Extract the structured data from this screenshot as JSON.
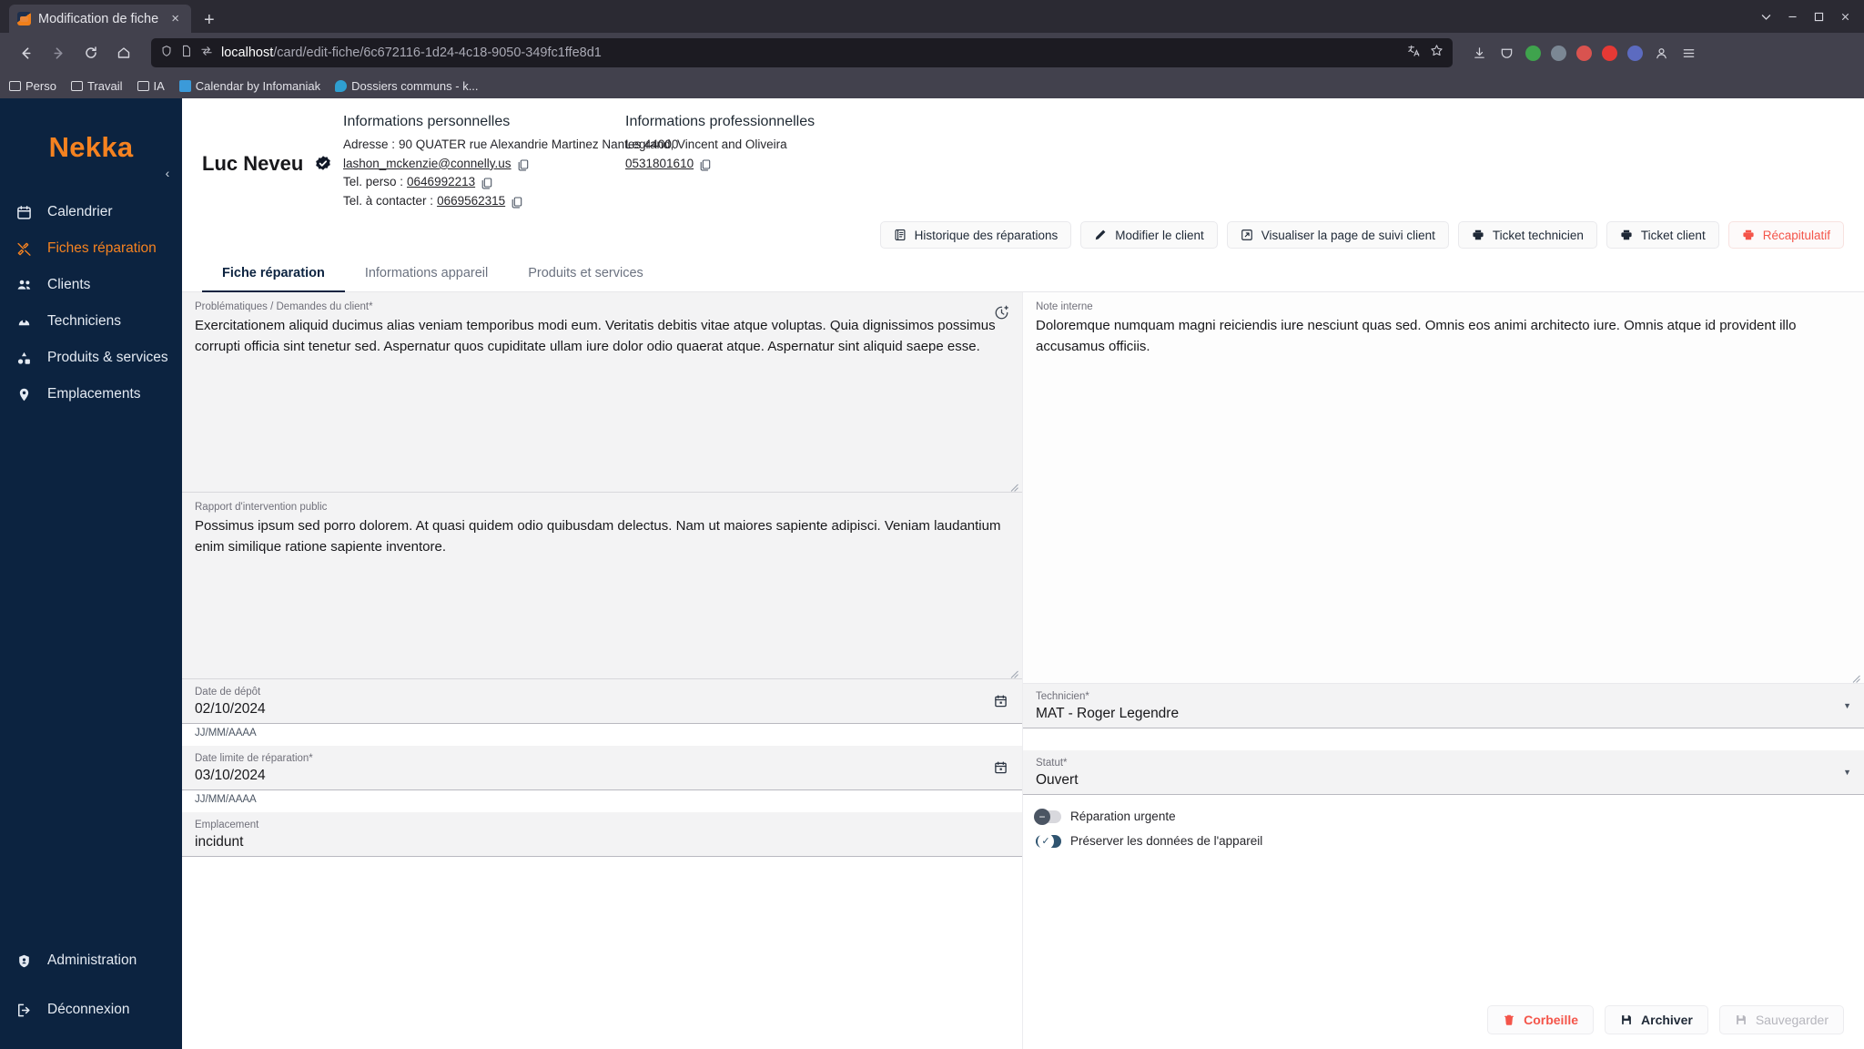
{
  "browser": {
    "tab_title": "Modification de fiche",
    "new_tab_label": "+",
    "close_label": "×",
    "url_prefix": "localhost",
    "url_path": "/card/edit-fiche/6c672116-1d24-4c18-9050-349fc1ffe8d1",
    "bookmarks": [
      {
        "label": "Perso",
        "icon": "folder-icon",
        "color": "#dcdce2"
      },
      {
        "label": "Travail",
        "icon": "folder-icon",
        "color": "#dcdce2"
      },
      {
        "label": "IA",
        "icon": "folder-icon",
        "color": "#dcdce2"
      },
      {
        "label": "Calendar by Infomaniak",
        "icon": "calendar-bookmark-icon",
        "color": "#3b9ad9"
      },
      {
        "label": "Dossiers communs - k...",
        "icon": "cloud-bookmark-icon",
        "color": "#2f9fd0"
      }
    ]
  },
  "sidebar": {
    "logo": "Nekka",
    "logo_color": "#f58220",
    "background": "#0c2340",
    "collapse_icon": "‹",
    "items": [
      {
        "label": "Calendrier",
        "icon": "calendar-icon",
        "active": false
      },
      {
        "label": "Fiches réparation",
        "icon": "tools-icon",
        "active": true
      },
      {
        "label": "Clients",
        "icon": "users-icon",
        "active": false
      },
      {
        "label": "Techniciens",
        "icon": "technician-icon",
        "active": false
      },
      {
        "label": "Produits & services",
        "icon": "products-icon",
        "active": false
      },
      {
        "label": "Emplacements",
        "icon": "location-pin-icon",
        "active": false
      }
    ],
    "bottom_items": [
      {
        "label": "Administration",
        "icon": "shield-icon"
      },
      {
        "label": "Déconnexion",
        "icon": "logout-icon"
      }
    ]
  },
  "client": {
    "name": "Luc Neveu",
    "verified_icon": "verified-badge-icon",
    "personal": {
      "title": "Informations personnelles",
      "address_label": "Adresse :",
      "address": "90 QUATER rue Alexandrie Martinez Nantes 44000",
      "email": "lashon_mckenzie@connelly.us",
      "phone_perso_label": "Tel. perso :",
      "phone_perso": "0646992213",
      "phone_contact_label": "Tel. à contacter :",
      "phone_contact": "0669562315"
    },
    "professional": {
      "title": "Informations professionnelles",
      "company": "Legrand, Vincent and Oliveira",
      "phone": "0531801610"
    }
  },
  "actions": [
    {
      "label": "Historique des réparations",
      "icon": "history-book-icon",
      "danger": false
    },
    {
      "label": "Modifier le client",
      "icon": "pencil-icon",
      "danger": false
    },
    {
      "label": "Visualiser la page de suivi client",
      "icon": "external-link-icon",
      "danger": false
    },
    {
      "label": "Ticket technicien",
      "icon": "printer-icon",
      "danger": false
    },
    {
      "label": "Ticket client",
      "icon": "printer-icon",
      "danger": false
    },
    {
      "label": "Récapitulatif",
      "icon": "printer-icon",
      "danger": true
    }
  ],
  "tabs": [
    {
      "label": "Fiche réparation",
      "active": true
    },
    {
      "label": "Informations appareil",
      "active": false
    },
    {
      "label": "Produits et services",
      "active": false
    }
  ],
  "form": {
    "problems": {
      "label": "Problématiques / Demandes du client*",
      "value": "Exercitationem aliquid ducimus alias veniam temporibus modi eum. Veritatis debitis vitae atque voluptas. Quia dignissimos possimus corrupti officia sint tenetur sed. Aspernatur quos cupiditate ullam iure dolor odio quaerat atque. Aspernatur sint aliquid saepe esse."
    },
    "public_report": {
      "label": "Rapport d'intervention public",
      "value": "Possimus ipsum sed porro dolorem. At quasi quidem odio quibusdam delectus. Nam ut maiores sapiente adipisci. Veniam laudantium enim similique ratione sapiente inventore."
    },
    "internal_note": {
      "label": "Note interne",
      "value": "Doloremque numquam magni reiciendis iure nesciunt quas sed. Omnis eos animi architecto iure. Omnis atque id provident illo accusamus officiis."
    },
    "deposit_date": {
      "label": "Date de dépôt",
      "value": "02/10/2024",
      "hint": "JJ/MM/AAAA"
    },
    "limit_date": {
      "label": "Date limite de réparation*",
      "value": "03/10/2024",
      "hint": "JJ/MM/AAAA"
    },
    "location": {
      "label": "Emplacement",
      "value": "incidunt"
    },
    "technician": {
      "label": "Technicien*",
      "value": "MAT - Roger Legendre"
    },
    "status": {
      "label": "Statut*",
      "value": "Ouvert"
    },
    "toggle_urgent": {
      "label": "Réparation urgente",
      "on": false
    },
    "toggle_preserve": {
      "label": "Préserver les données de l'appareil",
      "on": true
    }
  },
  "bottom_actions": [
    {
      "label": "Corbeille",
      "icon": "trash-icon",
      "style": "danger"
    },
    {
      "label": "Archiver",
      "icon": "save-disk-icon",
      "style": "normal"
    },
    {
      "label": "Sauvegarder",
      "icon": "save-disk-icon",
      "style": "disabled"
    }
  ]
}
